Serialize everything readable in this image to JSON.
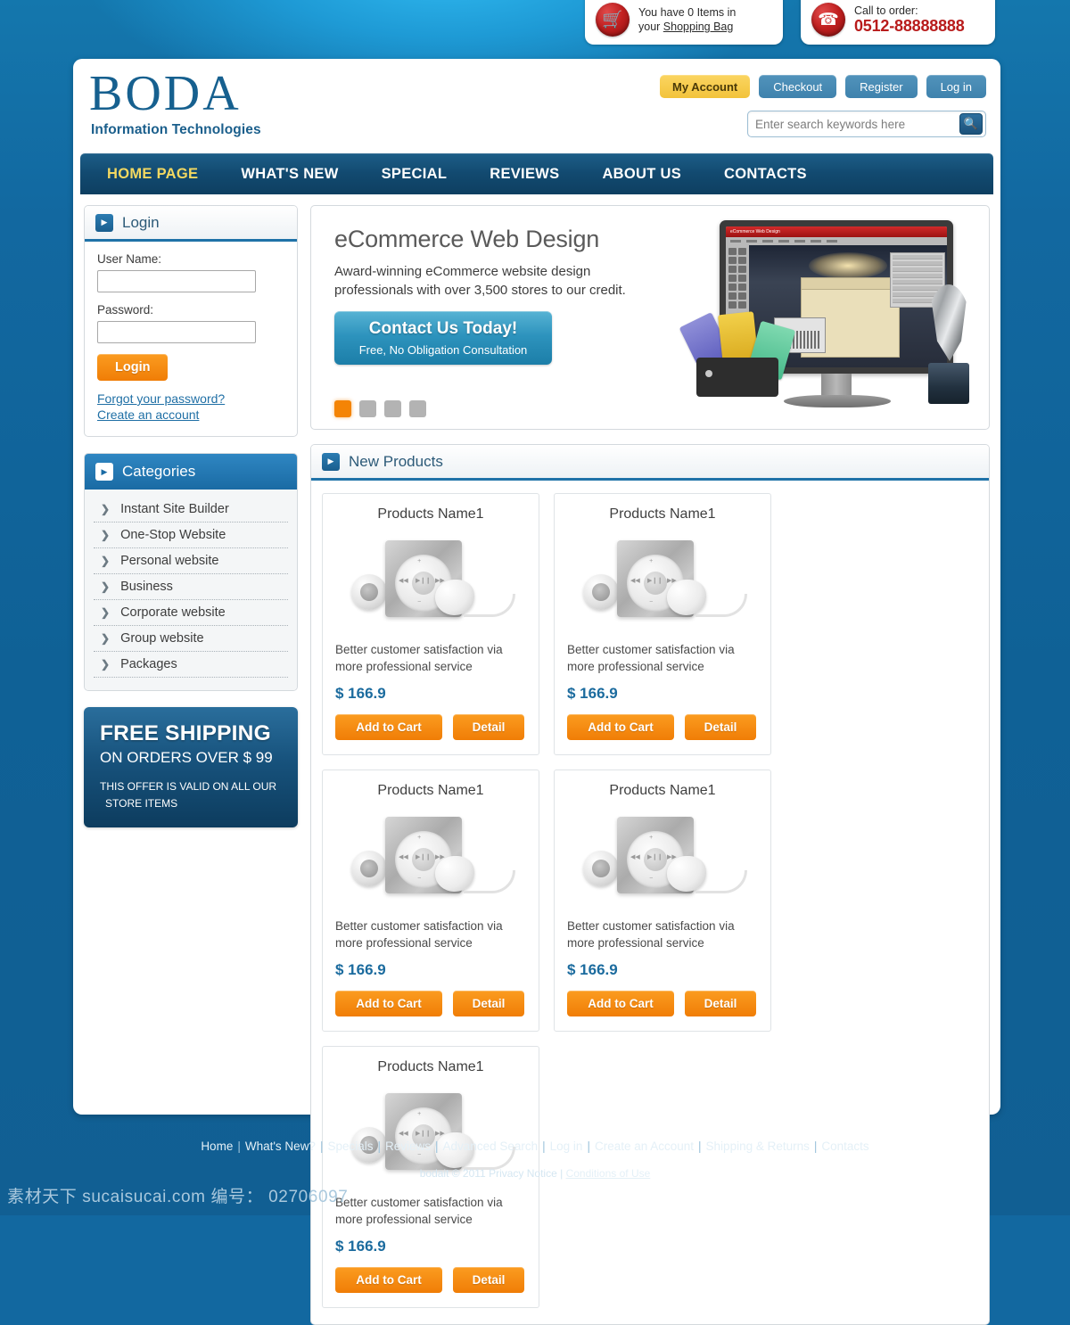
{
  "topbar": {
    "cart_icon": "shopping-cart-icon",
    "cart_text_line1": "You have 0 Items in",
    "cart_text_line2_prefix": "your ",
    "cart_link": "Shopping Bag",
    "phone_icon": "phone-icon",
    "phone_label": "Call to order:",
    "phone_number": "0512-88888888"
  },
  "header": {
    "brand": "BODA",
    "tagline": "Information Technologies",
    "account_buttons": [
      {
        "label": "My Account",
        "style": "gold"
      },
      {
        "label": "Checkout",
        "style": "blue"
      },
      {
        "label": "Register",
        "style": "blue"
      },
      {
        "label": "Log in",
        "style": "blue"
      }
    ],
    "search_placeholder": "Enter search keywords here",
    "search_value": "",
    "search_icon": "search-icon"
  },
  "nav": {
    "items": [
      {
        "label": "HOME PAGE",
        "active": true
      },
      {
        "label": "WHAT'S NEW",
        "active": false
      },
      {
        "label": "SPECIAL",
        "active": false
      },
      {
        "label": "REVIEWS",
        "active": false
      },
      {
        "label": "ABOUT US",
        "active": false
      },
      {
        "label": "CONTACTS",
        "active": false
      }
    ]
  },
  "login": {
    "title": "Login",
    "username_label": "User Name:",
    "username_value": "",
    "password_label": "Password:",
    "password_value": "",
    "submit_label": "Login",
    "forgot_link": "Forgot your password?",
    "create_link": "Create an account"
  },
  "categories": {
    "title": "Categories",
    "items": [
      {
        "label": "Instant Site Builder"
      },
      {
        "label": "One-Stop Website"
      },
      {
        "label": "Personal website"
      },
      {
        "label": "Business"
      },
      {
        "label": "Corporate website"
      },
      {
        "label": "Group website"
      },
      {
        "label": "Packages"
      }
    ]
  },
  "shipping": {
    "headline": "FREE SHIPPING",
    "subline": "ON ORDERS OVER $ 99",
    "note_line1": "THIS OFFER IS VALID ON ALL OUR",
    "note_line2": "STORE ITEMS"
  },
  "hero": {
    "title": "eCommerce Web Design",
    "paragraph": "Award-winning eCommerce website design professionals with over 3,500 stores to our credit.",
    "cta_main": "Contact Us Today!",
    "cta_sub": "Free, No Obligation Consultation",
    "dots": [
      {
        "active": true
      },
      {
        "active": false
      },
      {
        "active": false
      },
      {
        "active": false
      }
    ],
    "image_alt": "monitor-design-software-with-trophy-and-color-swatches",
    "screen_title": "eCommerce Web Design"
  },
  "products": {
    "title": "New Products",
    "items": [
      {
        "name": "Products Name1",
        "description": "Better customer satisfaction via more professional service",
        "price": "$ 166.9",
        "add_label": "Add to Cart",
        "detail_label": "Detail",
        "image_alt": "mp3-player-with-earbuds"
      },
      {
        "name": "Products Name1",
        "description": "Better customer satisfaction via more professional service",
        "price": "$ 166.9",
        "add_label": "Add to Cart",
        "detail_label": "Detail",
        "image_alt": "mp3-player-with-earbuds"
      },
      {
        "name": "Products Name1",
        "description": "Better customer satisfaction via more professional service",
        "price": "$ 166.9",
        "add_label": "Add to Cart",
        "detail_label": "Detail",
        "image_alt": "mp3-player-with-earbuds"
      },
      {
        "name": "Products Name1",
        "description": "Better customer satisfaction via more professional service",
        "price": "$ 166.9",
        "add_label": "Add to Cart",
        "detail_label": "Detail",
        "image_alt": "mp3-player-with-earbuds"
      },
      {
        "name": "Products Name1",
        "description": "Better customer satisfaction via more professional service",
        "price": "$ 166.9",
        "add_label": "Add to Cart",
        "detail_label": "Detail",
        "image_alt": "mp3-player-with-earbuds"
      }
    ]
  },
  "footer": {
    "links": [
      "Home",
      "What's New?",
      "Specials",
      "Reviews",
      "Advanced Search",
      "Log in",
      "Create an Account",
      "Shipping & Returns",
      "Contacts"
    ],
    "copyright_prefix": "bodait  © 2011  Privacy Notice",
    "copyright_sep": "|",
    "conditions_link": "Conditions of Use"
  },
  "watermark": {
    "text": "素材天下 sucaisucai.com  编号： 02706097"
  },
  "colors": {
    "page_bg": "#1268a0",
    "nav_bg": "#124a70",
    "accent_orange": "#f07d06",
    "accent_gold": "#f2c33b",
    "link_blue": "#1f6fa5",
    "price_blue": "#1b6b9e",
    "red": "#b81b1b"
  }
}
